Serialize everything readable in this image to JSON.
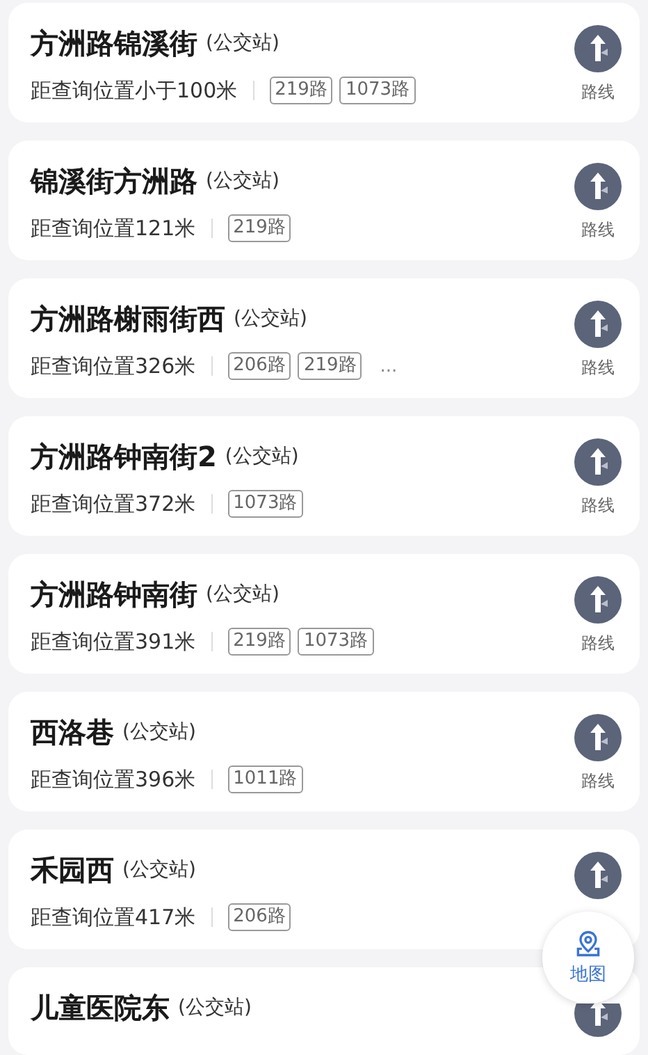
{
  "stations": [
    {
      "name": "方洲路锦溪街",
      "type": "(公交站)",
      "distance": "距查询位置小于100米",
      "routes": [
        "219路",
        "1073路"
      ],
      "route_label": "路线"
    },
    {
      "name": "锦溪街方洲路",
      "type": "(公交站)",
      "distance": "距查询位置121米",
      "routes": [
        "219路"
      ],
      "route_label": "路线"
    },
    {
      "name": "方洲路榭雨街西",
      "type": "(公交站)",
      "distance": "距查询位置326米",
      "routes": [
        "206路",
        "219路"
      ],
      "more": "...",
      "route_label": "路线"
    },
    {
      "name": "方洲路钟南街2",
      "type": "(公交站)",
      "distance": "距查询位置372米",
      "routes": [
        "1073路"
      ],
      "route_label": "路线"
    },
    {
      "name": "方洲路钟南街",
      "type": "(公交站)",
      "distance": "距查询位置391米",
      "routes": [
        "219路",
        "1073路"
      ],
      "route_label": "路线"
    },
    {
      "name": "西洛巷",
      "type": "(公交站)",
      "distance": "距查询位置396米",
      "routes": [
        "1011路"
      ],
      "route_label": "路线"
    },
    {
      "name": "禾园西",
      "type": "(公交站)",
      "distance": "距查询位置417米",
      "routes": [
        "206路"
      ]
    },
    {
      "name": "儿童医院东",
      "type": "(公交站)"
    }
  ],
  "map_button": {
    "label": "地图"
  }
}
